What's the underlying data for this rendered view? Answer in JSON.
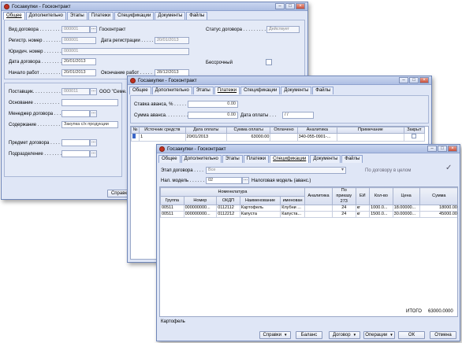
{
  "win1": {
    "title": "Госзакупки - Госконтракт",
    "tabs": [
      "Общее",
      "Дополнительно",
      "Этапы",
      "Платежи",
      "Спецификации",
      "Документы",
      "Файлы"
    ],
    "vid_label": "Вид договора . . . . . . . . . .",
    "vid_value": "000001",
    "vid_after": "Госконтракт",
    "status_label": "Статус договора . . . . . . . . .",
    "status_value": "Действует",
    "regnum_label": "Регистр. номер . . . . . . .",
    "regnum_value": "000001",
    "regdate_label": "Дата регистрации . . . . .",
    "regdate_value": "20/01/2013",
    "jur_label": "Юридич. номер . . . . . . . .",
    "jur_value": "000001",
    "date_label": "Дата договора . . . . . . . .",
    "date_value": "20/01/2013",
    "start_label": "Начало работ . . . . . . . . .",
    "start_value": "20/01/2013",
    "end_label": "Окончание работ . . . . .",
    "end_value": "28/12/2013",
    "indef_label": "Бессрочный",
    "supplier_label": "Поставщик. . . . . . . . . . . .",
    "supplier_value": "000011",
    "supplier_name": "ООО \"Семе...",
    "basis_label": "Основание . . . . . . . . . .",
    "manager_label": "Менеджер договора . . .",
    "content_label": "Содержание . . . . . . . . .",
    "content_value": "Закупка с/х продукции",
    "subject_label": "Предмет договора . . . . .",
    "division_label": "Подразделение . . . . . . .",
    "btn_spravki": "Справк"
  },
  "win2": {
    "title": "Госзакупки - Госконтракт",
    "tabs": [
      "Общее",
      "Дополнительно",
      "Этапы",
      "Платежи",
      "Спецификации",
      "Документы",
      "Файлы"
    ],
    "advance_rate_label": "Ставка аванса, % . . . . . .",
    "advance_rate_value": "0.00",
    "advance_sum_label": "Сумма аванса. . . . . . . . .",
    "advance_sum_value": "0.00",
    "pay_date_label": "Дата оплаты . . .",
    "pay_date_value": "  /  /",
    "columns": [
      "№",
      "Источник средств",
      "Дата оплаты",
      "Сумма оплаты",
      "Оплачено",
      "Аналитика",
      "Примечание",
      "Закрыт"
    ],
    "row": {
      "num": "",
      "source": "1",
      "date": "20/01/2013",
      "sum": "63000.00",
      "paid": "",
      "analytics": "340-055-0901-...",
      "note": "",
      "closed": ""
    }
  },
  "win3": {
    "title": "Госзакупки - Госконтракт",
    "tabs": [
      "Общее",
      "Дополнительно",
      "Этапы",
      "Платежи",
      "Спецификации",
      "Документы",
      "Файлы"
    ],
    "stage_label": "Этап договора . . . .",
    "stage_value": "Все",
    "by_contract": "По договору в целом",
    "tax_label": "Нал. модель . . . . . .",
    "tax_value": "02",
    "tax_adv_label": "Налоговая модель (аванс.)",
    "group_header": "Номенклатура",
    "columns": [
      "Группа",
      "Номер",
      "ОКДП",
      "Наименование",
      "",
      "Аналитика",
      "По приказу 273",
      "ЕИ",
      "Кол-во",
      "Цена",
      "Сумма"
    ],
    "name_sub": "именован",
    "rows": [
      {
        "group": "00511",
        "num": "000000000...",
        "okdp": "0112112",
        "name": "Картофель",
        "name2": "Клубни ...",
        "analytics": "",
        "order": "24",
        "unit": "кг",
        "qty": "1000.0...",
        "price": "18.00000...",
        "sum": "18000.00"
      },
      {
        "group": "00511",
        "num": "000000000...",
        "okdp": "0112212",
        "name": "Капуста",
        "name2": "Капуста...",
        "analytics": "",
        "order": "24",
        "unit": "кг",
        "qty": "1500.0...",
        "price": "30.00000...",
        "sum": "45000.00"
      }
    ],
    "total_label": "ИТОГО",
    "total_value": "63000.0000",
    "footer_text": "Картофель",
    "btn_spravki": "Справки",
    "btn_balance": "Баланс",
    "btn_contract": "Договор",
    "btn_operations": "Операции",
    "btn_ok": "ОК",
    "btn_cancel": "Отмена"
  },
  "icons": {
    "app": "app-icon",
    "minimize": "minimize-icon",
    "maximize": "maximize-icon",
    "close": "close-icon"
  }
}
